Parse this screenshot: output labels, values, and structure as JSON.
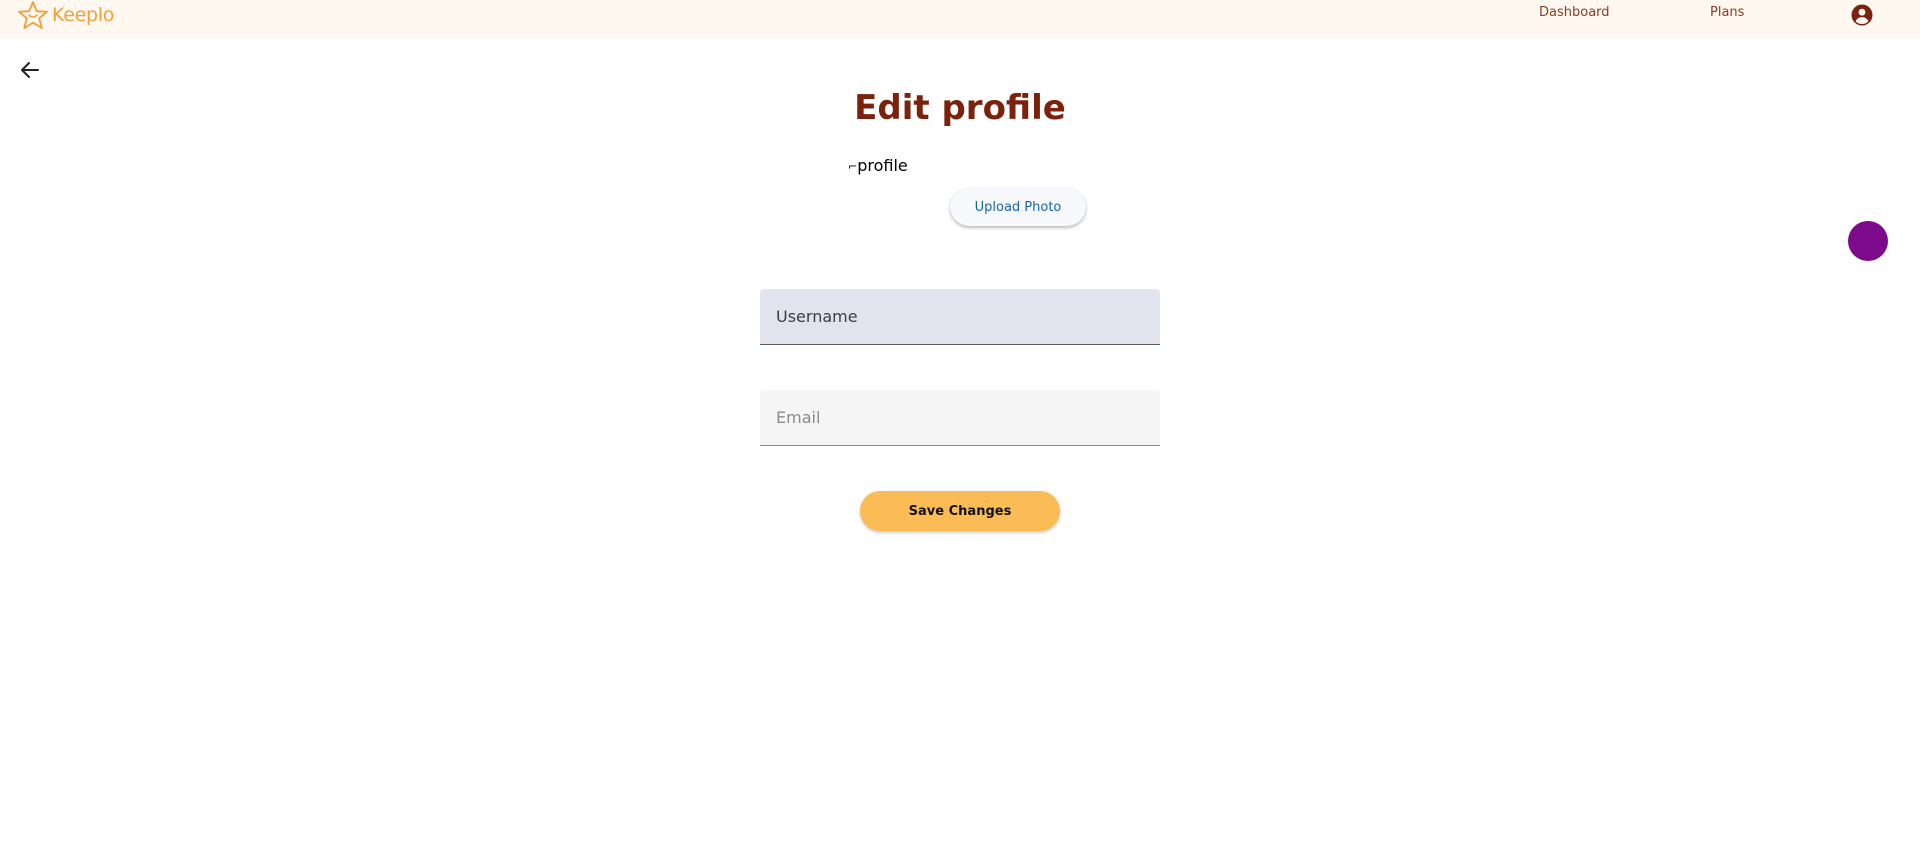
{
  "header": {
    "brand_name": "Keeplo",
    "logo_icon": "star-logo-icon",
    "nav": {
      "dashboard_label": "Dashboard",
      "plans_label": "Plans"
    },
    "account_icon": "account-circle-icon"
  },
  "page": {
    "back_icon": "arrow-left-icon",
    "title": "Edit profile",
    "profile_image_alt": "profile",
    "upload_label": "Upload Photo",
    "fab_color": "#7c0a8a"
  },
  "form": {
    "username": {
      "value": "",
      "placeholder": "Username"
    },
    "email": {
      "value": "",
      "placeholder": "Email"
    },
    "save_label": "Save Changes"
  },
  "colors": {
    "brand": "#f0a03a",
    "title": "#7a220c",
    "nav_text": "#8a3b22",
    "save_button": "#fbbc55",
    "upload_text": "#1565a8"
  }
}
